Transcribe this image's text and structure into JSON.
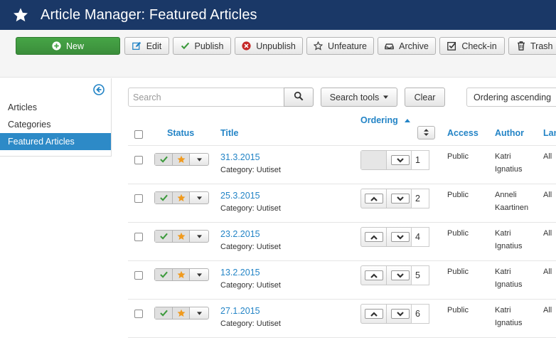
{
  "header": {
    "title": "Article Manager: Featured Articles"
  },
  "toolbar": {
    "buttons": [
      {
        "label": "New",
        "icon": "plus-circle-icon"
      },
      {
        "label": "Edit",
        "icon": "edit-icon"
      },
      {
        "label": "Publish",
        "icon": "check-icon"
      },
      {
        "label": "Unpublish",
        "icon": "x-circle-icon"
      },
      {
        "label": "Unfeature",
        "icon": "star-outline-icon"
      },
      {
        "label": "Archive",
        "icon": "archive-icon"
      },
      {
        "label": "Check-in",
        "icon": "checkbox-icon"
      },
      {
        "label": "Trash",
        "icon": "trash-icon"
      }
    ]
  },
  "sidebar": {
    "items": [
      {
        "label": "Articles"
      },
      {
        "label": "Categories"
      },
      {
        "label": "Featured Articles",
        "active": true
      }
    ]
  },
  "filters": {
    "search_placeholder": "Search",
    "search_tools_label": "Search tools",
    "clear_label": "Clear",
    "ordering_label": "Ordering ascending"
  },
  "table": {
    "headers": {
      "status": "Status",
      "title": "Title",
      "ordering": "Ordering",
      "access": "Access",
      "author": "Author",
      "language": "Lan"
    },
    "rows": [
      {
        "title": "31.3.2015",
        "category": "Category: Uutiset",
        "ordering": "1",
        "access": "Public",
        "author_line1": "Katri",
        "author_line2": "Ignatius",
        "language": "All"
      },
      {
        "title": "25.3.2015",
        "category": "Category: Uutiset",
        "ordering": "2",
        "access": "Public",
        "author_line1": "Anneli",
        "author_line2": "Kaartinen",
        "language": "All"
      },
      {
        "title": "23.2.2015",
        "category": "Category: Uutiset",
        "ordering": "4",
        "access": "Public",
        "author_line1": "Katri",
        "author_line2": "Ignatius",
        "language": "All"
      },
      {
        "title": "13.2.2015",
        "category": "Category: Uutiset",
        "ordering": "5",
        "access": "Public",
        "author_line1": "Katri",
        "author_line2": "Ignatius",
        "language": "All"
      },
      {
        "title": "27.1.2015",
        "category": "Category: Uutiset",
        "ordering": "6",
        "access": "Public",
        "author_line1": "Katri",
        "author_line2": "Ignatius",
        "language": "All"
      }
    ]
  },
  "colors": {
    "header_bg": "#1a3867",
    "new_button": "#46a546",
    "active_item": "#2d8ac7",
    "link": "#2384c6",
    "check_green": "#3c9a3c",
    "star_orange": "#f09a1e"
  }
}
